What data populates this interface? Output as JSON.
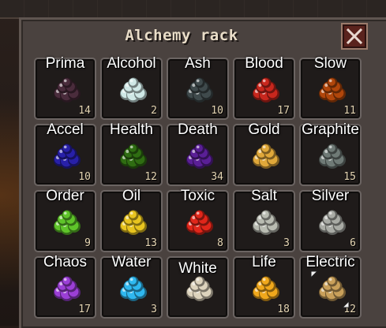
{
  "window": {
    "title": "Alchemy rack",
    "close_icon": "close-x-icon"
  },
  "items": [
    {
      "label": "Prima",
      "count": "14",
      "color": "#4a2c3c",
      "icon": "ore-pile-icon"
    },
    {
      "label": "Alcohol",
      "count": "2",
      "color": "#cfe8e6",
      "icon": "ore-pile-icon"
    },
    {
      "label": "Ash",
      "count": "10",
      "color": "#3f4a4c",
      "icon": "ore-pile-icon"
    },
    {
      "label": "Blood",
      "count": "17",
      "color": "#c8271d",
      "icon": "ore-pile-icon"
    },
    {
      "label": "Slow",
      "count": "11",
      "color": "#b0460b",
      "icon": "ore-pile-icon"
    },
    {
      "label": "Accel",
      "count": "10",
      "color": "#2820a8",
      "icon": "ore-pile-icon"
    },
    {
      "label": "Health",
      "count": "12",
      "color": "#2f6d12",
      "icon": "ore-pile-icon"
    },
    {
      "label": "Death",
      "count": "34",
      "color": "#5a1f96",
      "icon": "ore-pile-icon"
    },
    {
      "label": "Gold",
      "count": "",
      "color": "#e0a83a",
      "icon": "ore-pile-icon"
    },
    {
      "label": "Graphite",
      "count": "15",
      "color": "#6f7a76",
      "icon": "ore-pile-icon"
    },
    {
      "label": "Order",
      "count": "9",
      "color": "#5fc42a",
      "icon": "ore-pile-icon"
    },
    {
      "label": "Oil",
      "count": "13",
      "color": "#e8c41f",
      "icon": "ore-pile-icon"
    },
    {
      "label": "Toxic",
      "count": "8",
      "color": "#e0261a",
      "icon": "ore-pile-icon"
    },
    {
      "label": "Salt",
      "count": "3",
      "color": "#b9bcb2",
      "icon": "ore-pile-icon"
    },
    {
      "label": "Silver",
      "count": "6",
      "color": "#a9aba5",
      "icon": "ore-pile-icon"
    },
    {
      "label": "Chaos",
      "count": "17",
      "color": "#9b3fd6",
      "icon": "ore-pile-icon"
    },
    {
      "label": "Water",
      "count": "3",
      "color": "#2fb8f0",
      "icon": "ore-pile-icon"
    },
    {
      "label": "White",
      "count": "",
      "color": "#ddd3bd",
      "icon": "ore-pile-icon"
    },
    {
      "label": "Life",
      "count": "18",
      "color": "#f0a81c",
      "icon": "ore-pile-icon"
    },
    {
      "label": "Electric",
      "count": "12",
      "color": "#c9a05a",
      "icon": "ore-pile-icon"
    }
  ]
}
